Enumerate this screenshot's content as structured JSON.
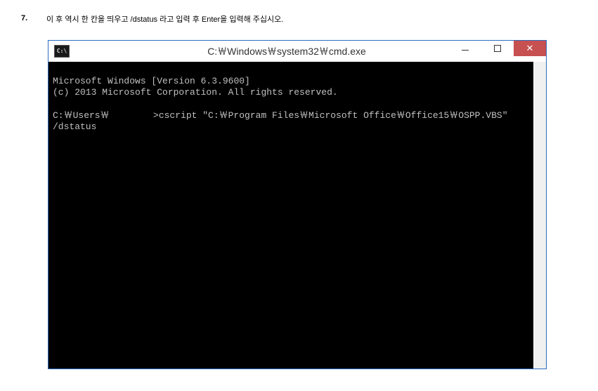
{
  "step": {
    "number": "7.",
    "text": "이 후 역시 한 칸을 띄우고 /dstatus 라고 입력 후 Enter을 입력해 주십시오."
  },
  "window": {
    "title": "C:￦Windows￦system32￦cmd.exe",
    "icon_text": "C:\\"
  },
  "terminal": {
    "line1": "Microsoft Windows [Version 6.3.9600]",
    "line2": "(c) 2013 Microsoft Corporation. All rights reserved.",
    "line3": "",
    "line4": "C:￦Users￦        >cscript \"C:￦Program Files￦Microsoft Office￦Office15￦OSPP.VBS\"",
    "line5": "/dstatus"
  }
}
